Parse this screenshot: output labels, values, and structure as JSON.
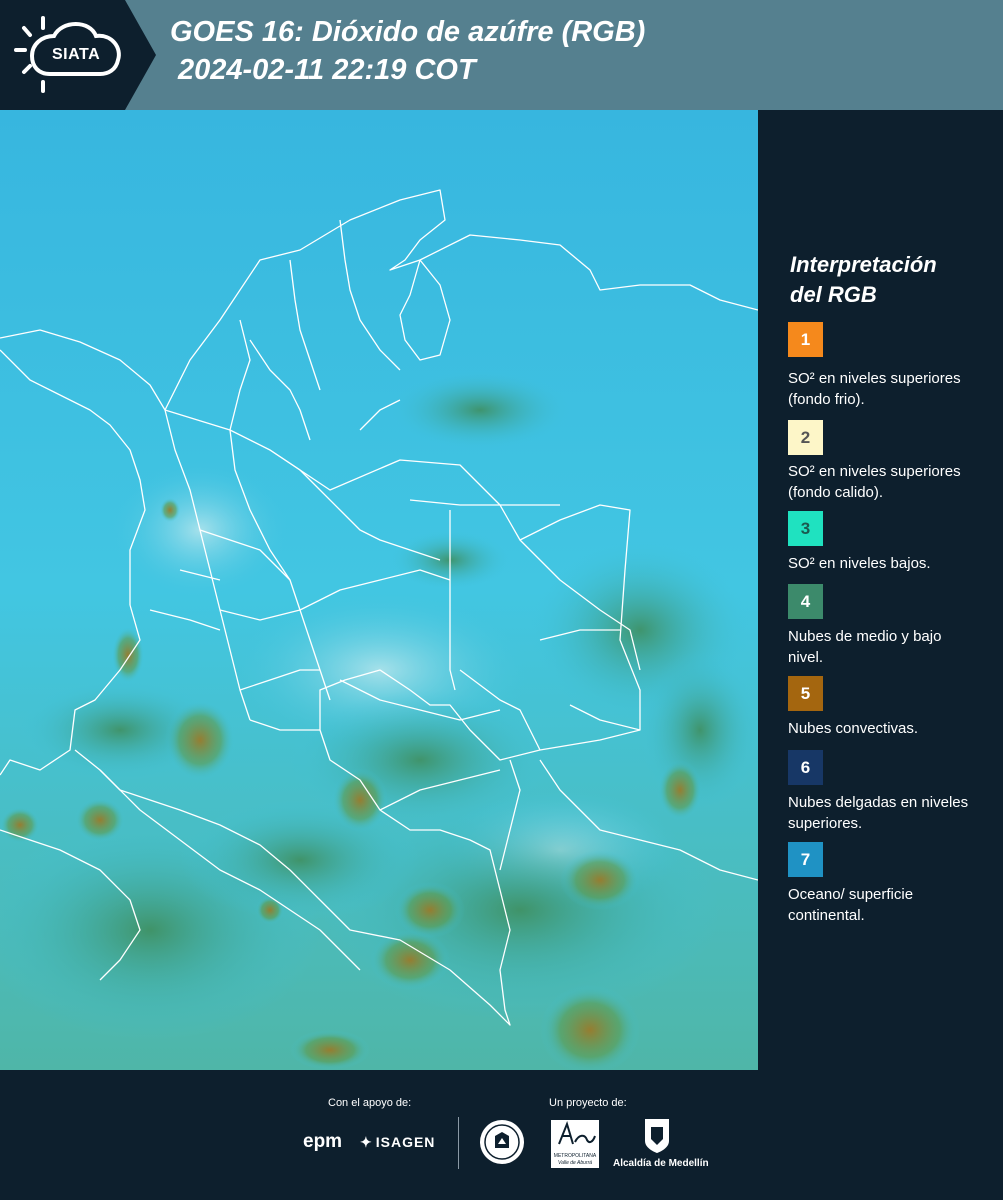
{
  "header": {
    "logo_text": "SIATA",
    "title_line1": "GOES 16: Dióxido de azúfre (RGB)",
    "title_line2": "2024-02-11 22:19 COT"
  },
  "legend": {
    "title_line1": "Interpretación",
    "title_line2": "del RGB",
    "items": [
      {
        "num": "1",
        "color": "#f5891c",
        "num_color": "#ffffff",
        "label": "SO² en niveles superiores (fondo frio)."
      },
      {
        "num": "2",
        "color": "#fdf6c8",
        "num_color": "#555555",
        "label": "SO² en niveles superiores (fondo calido)."
      },
      {
        "num": "3",
        "color": "#1fe2c0",
        "num_color": "#1b5a50",
        "label": "SO² en niveles bajos."
      },
      {
        "num": "4",
        "color": "#3c8a6b",
        "num_color": "#ffffff",
        "label": "Nubes de medio y bajo nivel."
      },
      {
        "num": "5",
        "color": "#a4660f",
        "num_color": "#ffffff",
        "label": "Nubes convectivas."
      },
      {
        "num": "6",
        "color": "#173766",
        "num_color": "#ffffff",
        "label": "Nubes delgadas en niveles superiores."
      },
      {
        "num": "7",
        "color": "#1f92c4",
        "num_color": "#ffffff",
        "label": "Oceano/ superficie continental."
      }
    ]
  },
  "footer": {
    "support_label": "Con el apoyo de:",
    "project_label": "Un proyecto de:",
    "epm": "epm",
    "isagen": "ISAGEN",
    "metropolitana_line1": "METROPOLITANA",
    "metropolitana_line2": "Valle de Aburrá",
    "alcaldia": "Alcaldía de Medellín"
  },
  "colors": {
    "background": "#0d1f2d",
    "header": "#55808f",
    "map_base": "#3fc4e0"
  }
}
